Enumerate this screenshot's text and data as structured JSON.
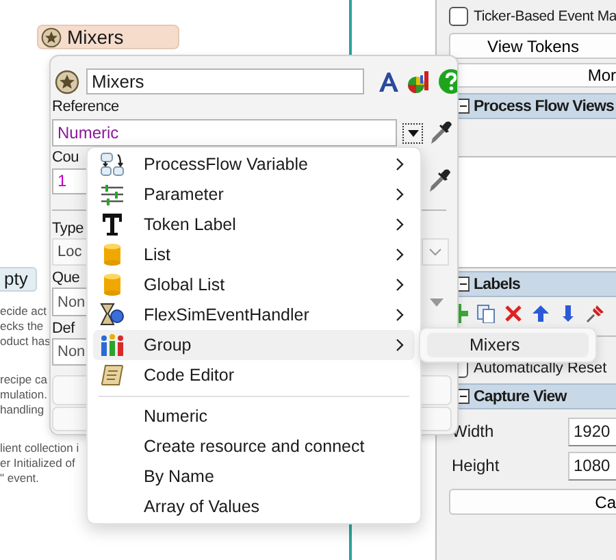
{
  "canvas": {
    "node": {
      "label": "Mixers"
    },
    "tag": {
      "label": "pty"
    },
    "notes": [
      "ecide act\necks the\noduct has",
      "recipe ca\nmulation.\nhandling",
      "lient collection i\ner Initialized of\n\" event."
    ]
  },
  "side_panel": {
    "ticker": {
      "label": "Ticker-Based Event Ma",
      "checked": false
    },
    "buttons": [
      "View Tokens",
      "Mor"
    ],
    "process_flow_views": {
      "title": "Process Flow Views",
      "expanded": true
    },
    "labels": {
      "title": "Labels",
      "expanded": true
    },
    "auto_reset": {
      "label": "Automatically Reset",
      "checked": false
    },
    "capture_view": {
      "title": "Capture View",
      "expanded": true,
      "fields": [
        {
          "label": "Width",
          "value": "1920"
        },
        {
          "label": "Height",
          "value": "1080"
        }
      ],
      "button": "Ca"
    }
  },
  "popup": {
    "name": "Mixers",
    "fields": [
      {
        "kind": "reference",
        "label": "Reference",
        "value": "Numeric"
      },
      {
        "kind": "count",
        "label": "Cou",
        "value": "1"
      },
      {
        "kind": "select",
        "label": "Type",
        "value": "Loc"
      },
      {
        "kind": "combo",
        "label": "Que",
        "value": "Non"
      },
      {
        "kind": "plain",
        "label": "Def",
        "value": "Non"
      }
    ]
  },
  "context_menu": {
    "items": [
      {
        "kind": "variable",
        "label": "ProcessFlow Variable",
        "submenu": true,
        "selected": false
      },
      {
        "kind": "parameter",
        "label": "Parameter",
        "submenu": true,
        "selected": false
      },
      {
        "kind": "token_label",
        "label": "Token Label",
        "submenu": true,
        "selected": false
      },
      {
        "kind": "list",
        "label": "List",
        "submenu": true,
        "selected": false
      },
      {
        "kind": "list",
        "label": "Global List",
        "submenu": true,
        "selected": false
      },
      {
        "kind": "event_handler",
        "label": "FlexSimEventHandler",
        "submenu": true,
        "selected": false
      },
      {
        "kind": "group",
        "label": "Group",
        "submenu": true,
        "selected": true
      },
      {
        "kind": "code",
        "label": "Code Editor",
        "submenu": false,
        "selected": false
      },
      {
        "kind": "separator"
      },
      {
        "kind": "text",
        "label": "Numeric",
        "submenu": false,
        "selected": false
      },
      {
        "kind": "text",
        "label": "Create resource and connect",
        "submenu": false,
        "selected": false
      },
      {
        "kind": "text",
        "label": "By Name",
        "submenu": false,
        "selected": false
      },
      {
        "kind": "text",
        "label": "Array of Values",
        "submenu": false,
        "selected": false
      }
    ]
  },
  "submenu": {
    "items": [
      {
        "label": "Mixers",
        "selected": true
      }
    ]
  }
}
